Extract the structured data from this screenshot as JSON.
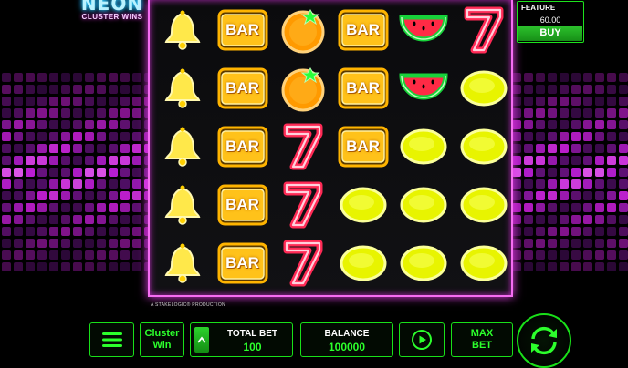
{
  "game": {
    "logo_main": "NEON",
    "logo_sub": "CLUSTER WINS"
  },
  "symbols": {
    "bar_label": "BAR"
  },
  "reels": [
    [
      "bell",
      "bell",
      "bell",
      "bell",
      "bell"
    ],
    [
      "bar",
      "bar",
      "bar",
      "bar",
      "bar"
    ],
    [
      "orange",
      "orange",
      "seven",
      "seven",
      "seven"
    ],
    [
      "bar",
      "bar",
      "bar",
      "lemon",
      "lemon"
    ],
    [
      "watermelon",
      "watermelon",
      "lemon",
      "lemon",
      "lemon"
    ],
    [
      "seven",
      "lemon",
      "lemon",
      "lemon",
      "lemon"
    ]
  ],
  "footer": {
    "production": "A STAKELOGIC® PRODUCTION"
  },
  "feature": {
    "label": "FEATURE",
    "value": "60.00",
    "buy_label": "BUY"
  },
  "controls": {
    "menu_icon": "hamburger-menu-icon",
    "cluster_line1": "Cluster",
    "cluster_line2": "Win",
    "total_bet_label": "TOTAL BET",
    "total_bet_value": "100",
    "balance_label": "BALANCE",
    "balance_value": "100000",
    "autoplay_icon": "play-circle-icon",
    "max_line1": "MAX",
    "max_line2": "BET",
    "spin_icon": "spin-arrows-icon"
  },
  "colors": {
    "accent_green": "#19e019",
    "frame_pink": "#f56df2",
    "bar_gold": "#ffb400"
  }
}
